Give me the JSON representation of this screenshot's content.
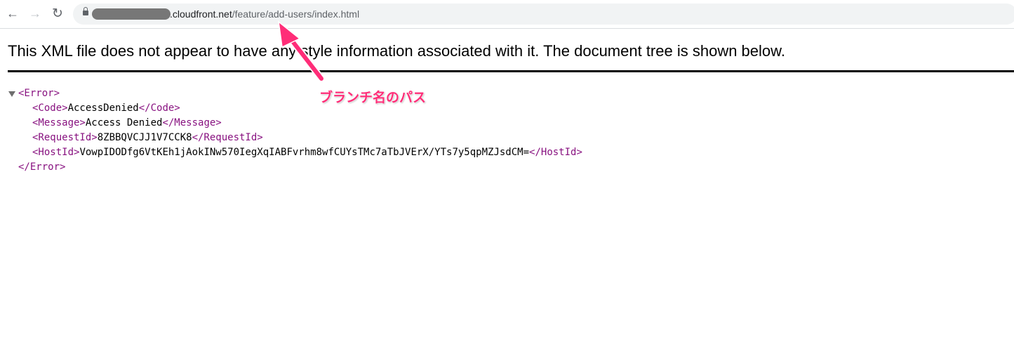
{
  "browser": {
    "back_icon": "arrow-left-icon",
    "forward_icon": "arrow-right-icon",
    "reload_icon": "reload-icon",
    "url_host_visible": ".cloudfront.net",
    "url_path": "/feature/add-users/index.html"
  },
  "page": {
    "notice": "This XML file does not appear to have any style information associated with it. The document tree is shown below.",
    "xml": {
      "root_open": "<Error>",
      "root_close": "</Error>",
      "children": [
        {
          "open": "<Code>",
          "value": "AccessDenied",
          "close": "</Code>"
        },
        {
          "open": "<Message>",
          "value": "Access Denied",
          "close": "</Message>"
        },
        {
          "open": "<RequestId>",
          "value": "8ZBBQVCJJ1V7CCK8",
          "close": "</RequestId>"
        },
        {
          "open": "<HostId>",
          "value": "VowpIDODfg6VtKEh1jAokINw570IegXqIABFvrhm8wfCUYsTMc7aTbJVErX/YTs7y5qpMZJsdCM=",
          "close": "</HostId>"
        }
      ]
    }
  },
  "annotation": {
    "label": "ブランチ名のパス",
    "color": "#ff2d78"
  }
}
